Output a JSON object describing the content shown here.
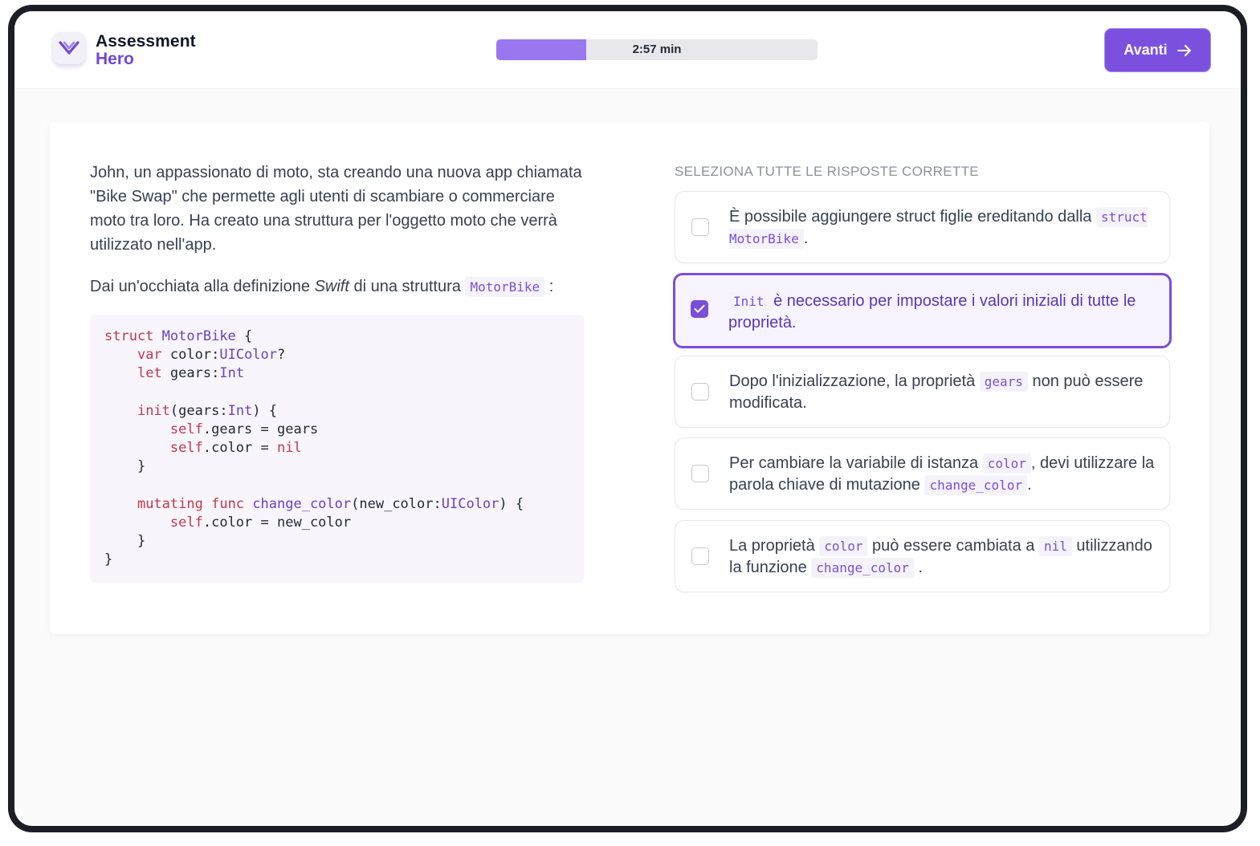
{
  "header": {
    "brand_line1": "Assessment",
    "brand_line2": "Hero",
    "logo_icon": "chevron-heart-icon",
    "timer": "2:57 min",
    "progress_fraction": 0.28,
    "next_label": "Avanti",
    "next_icon": "arrow-right-icon"
  },
  "question": {
    "intro": "John, un appassionato di moto, sta creando una nuova app chiamata \"Bike Swap\" che permette agli utenti di scambiare o commerciare moto tra loro. Ha creato una struttura per l'oggetto moto che verrà utilizzato nell'app.",
    "prompt_before": "Dai un'occhiata alla definizione ",
    "prompt_emph": "Swift",
    "prompt_middle": " di una struttura ",
    "prompt_code": "MotorBike",
    "prompt_after": " :",
    "code_lines": [
      "struct MotorBike {",
      "    var color:UIColor?",
      "    let gears:Int",
      "",
      "    init(gears:Int) {",
      "        self.gears = gears",
      "        self.color = nil",
      "    }",
      "",
      "    mutating func change_color(new_color:UIColor) {",
      "        self.color = new_color",
      "    }",
      "}"
    ]
  },
  "answers": {
    "instruction": "SELEZIONA TUTTE LE RISPOSTE CORRETTE",
    "options": [
      {
        "selected": false,
        "parts": [
          {
            "t": "È possibile aggiungere struct figlie ereditando dalla "
          },
          {
            "c": "struct MotorBike"
          },
          {
            "t": "."
          }
        ]
      },
      {
        "selected": true,
        "parts": [
          {
            "c": "Init"
          },
          {
            "t": " è necessario per impostare i valori iniziali di tutte le proprietà."
          }
        ]
      },
      {
        "selected": false,
        "parts": [
          {
            "t": "Dopo l'inizializzazione, la proprietà "
          },
          {
            "c": "gears"
          },
          {
            "t": " non può essere modificata."
          }
        ]
      },
      {
        "selected": false,
        "parts": [
          {
            "t": "Per cambiare la variabile di istanza "
          },
          {
            "c": "color"
          },
          {
            "t": ", devi utilizzare la parola chiave di mutazione "
          },
          {
            "c": "change_color"
          },
          {
            "t": "."
          }
        ]
      },
      {
        "selected": false,
        "parts": [
          {
            "t": "La proprietà "
          },
          {
            "c": "color"
          },
          {
            "t": " può essere cambiata a "
          },
          {
            "c": "nil"
          },
          {
            "t": " utilizzando la funzione "
          },
          {
            "c": "change_color"
          },
          {
            "t": " ."
          }
        ]
      }
    ]
  },
  "colors": {
    "accent": "#7b50df",
    "selected_text": "#5b35b8",
    "code_keyword": "#c2384b",
    "code_type": "#6b3fc4"
  }
}
